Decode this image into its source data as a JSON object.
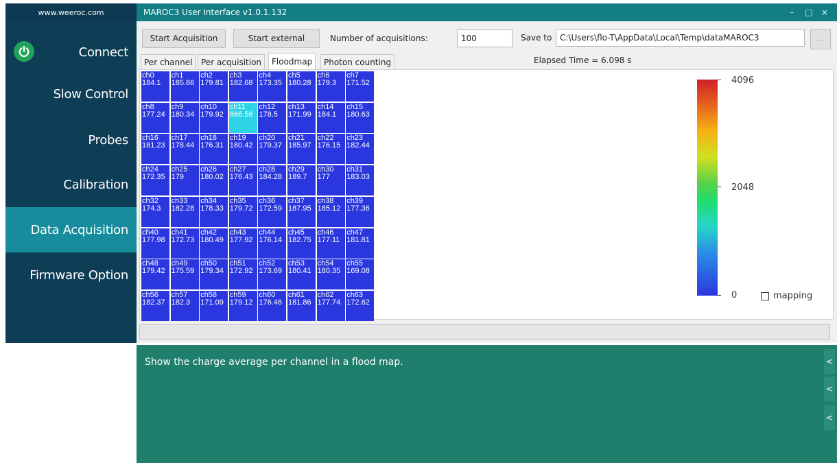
{
  "sidebar": {
    "site": "www.weeroc.com",
    "items": [
      {
        "label": "Connect"
      },
      {
        "label": "Slow Control"
      },
      {
        "label": "Probes"
      },
      {
        "label": "Calibration"
      },
      {
        "label": "Data Acquisition",
        "active": true
      },
      {
        "label": "Firmware Option"
      }
    ]
  },
  "window": {
    "title": "MAROC3 User Interface v1.0.1.132",
    "controls": [
      "–",
      "□",
      "×"
    ]
  },
  "toolbar": {
    "start_acquisition": "Start Acquisition",
    "start_external": "Start external",
    "num_acq_label": "Number of acquisitions:",
    "num_acq_value": "100",
    "save_to_label": "Save to",
    "save_path": "C:\\Users\\flo-T\\AppData\\Local\\Temp\\dataMAROC3",
    "browse": "...",
    "elapsed": "Elapsed Time = 6.098 s"
  },
  "tabs": [
    {
      "label": "Per channel"
    },
    {
      "label": "Per acquisition"
    },
    {
      "label": "Floodmap",
      "active": true
    },
    {
      "label": "Photon counting"
    }
  ],
  "floodmap": {
    "channels": [
      {
        "name": "ch0",
        "value": "184.1"
      },
      {
        "name": "ch1",
        "value": "185.66"
      },
      {
        "name": "ch2",
        "value": "179.81"
      },
      {
        "name": "ch3",
        "value": "182.68"
      },
      {
        "name": "ch4",
        "value": "173.35"
      },
      {
        "name": "ch5",
        "value": "180.28"
      },
      {
        "name": "ch6",
        "value": "179.3"
      },
      {
        "name": "ch7",
        "value": "171.52"
      },
      {
        "name": "ch8",
        "value": "177.24"
      },
      {
        "name": "ch9",
        "value": "180.34"
      },
      {
        "name": "ch10",
        "value": "179.92"
      },
      {
        "name": "ch11",
        "value": "866.56",
        "hot": true
      },
      {
        "name": "ch12",
        "value": "178.5"
      },
      {
        "name": "ch13",
        "value": "171.99"
      },
      {
        "name": "ch14",
        "value": "184.1"
      },
      {
        "name": "ch15",
        "value": "180.63"
      },
      {
        "name": "ch16",
        "value": "181.23"
      },
      {
        "name": "ch17",
        "value": "178.44"
      },
      {
        "name": "ch18",
        "value": "176.31"
      },
      {
        "name": "ch19",
        "value": "180.42"
      },
      {
        "name": "ch20",
        "value": "179.37"
      },
      {
        "name": "ch21",
        "value": "185.97"
      },
      {
        "name": "ch22",
        "value": "176.15"
      },
      {
        "name": "ch23",
        "value": "182.44"
      },
      {
        "name": "ch24",
        "value": "172.35"
      },
      {
        "name": "ch25",
        "value": "179"
      },
      {
        "name": "ch26",
        "value": "180.02"
      },
      {
        "name": "ch27",
        "value": "176.43"
      },
      {
        "name": "ch28",
        "value": "184.28"
      },
      {
        "name": "ch29",
        "value": "189.7"
      },
      {
        "name": "ch30",
        "value": "177"
      },
      {
        "name": "ch31",
        "value": "183.03"
      },
      {
        "name": "ch32",
        "value": "174.3"
      },
      {
        "name": "ch33",
        "value": "182.28"
      },
      {
        "name": "ch34",
        "value": "178.33"
      },
      {
        "name": "ch35",
        "value": "179.72"
      },
      {
        "name": "ch36",
        "value": "172.59"
      },
      {
        "name": "ch37",
        "value": "187.95"
      },
      {
        "name": "ch38",
        "value": "185.12"
      },
      {
        "name": "ch39",
        "value": "177.36"
      },
      {
        "name": "ch40",
        "value": "177.98"
      },
      {
        "name": "ch41",
        "value": "172.73"
      },
      {
        "name": "ch42",
        "value": "180.49"
      },
      {
        "name": "ch43",
        "value": "177.92"
      },
      {
        "name": "ch44",
        "value": "176.14"
      },
      {
        "name": "ch45",
        "value": "182.75"
      },
      {
        "name": "ch46",
        "value": "177.11"
      },
      {
        "name": "ch47",
        "value": "181.81"
      },
      {
        "name": "ch48",
        "value": "179.42"
      },
      {
        "name": "ch49",
        "value": "175.59"
      },
      {
        "name": "ch50",
        "value": "179.34"
      },
      {
        "name": "ch51",
        "value": "172.92"
      },
      {
        "name": "ch52",
        "value": "173.69"
      },
      {
        "name": "ch53",
        "value": "180.41"
      },
      {
        "name": "ch54",
        "value": "180.35"
      },
      {
        "name": "ch55",
        "value": "169.08"
      },
      {
        "name": "ch56",
        "value": "182.37"
      },
      {
        "name": "ch57",
        "value": "182.3"
      },
      {
        "name": "ch58",
        "value": "171.09"
      },
      {
        "name": "ch59",
        "value": "179.12"
      },
      {
        "name": "ch60",
        "value": "176.46"
      },
      {
        "name": "ch61",
        "value": "181.86"
      },
      {
        "name": "ch62",
        "value": "177.74"
      },
      {
        "name": "ch63",
        "value": "172.62"
      }
    ],
    "colorbar": {
      "max": "4096",
      "mid": "2048",
      "min": "0"
    },
    "mapping_label": "mapping",
    "mapping_checked": false
  },
  "help": {
    "text": "Show the charge average per channel in a flood map.",
    "collapse_glyph": "<"
  },
  "colors": {
    "sidebar_bg": "#0e3d56",
    "sidebar_active": "#168c9c",
    "titlebar": "#127d85",
    "help_bg": "#1f7e6c",
    "cell_cold": "#2a37df",
    "cell_hot": "#2fd3e6"
  }
}
